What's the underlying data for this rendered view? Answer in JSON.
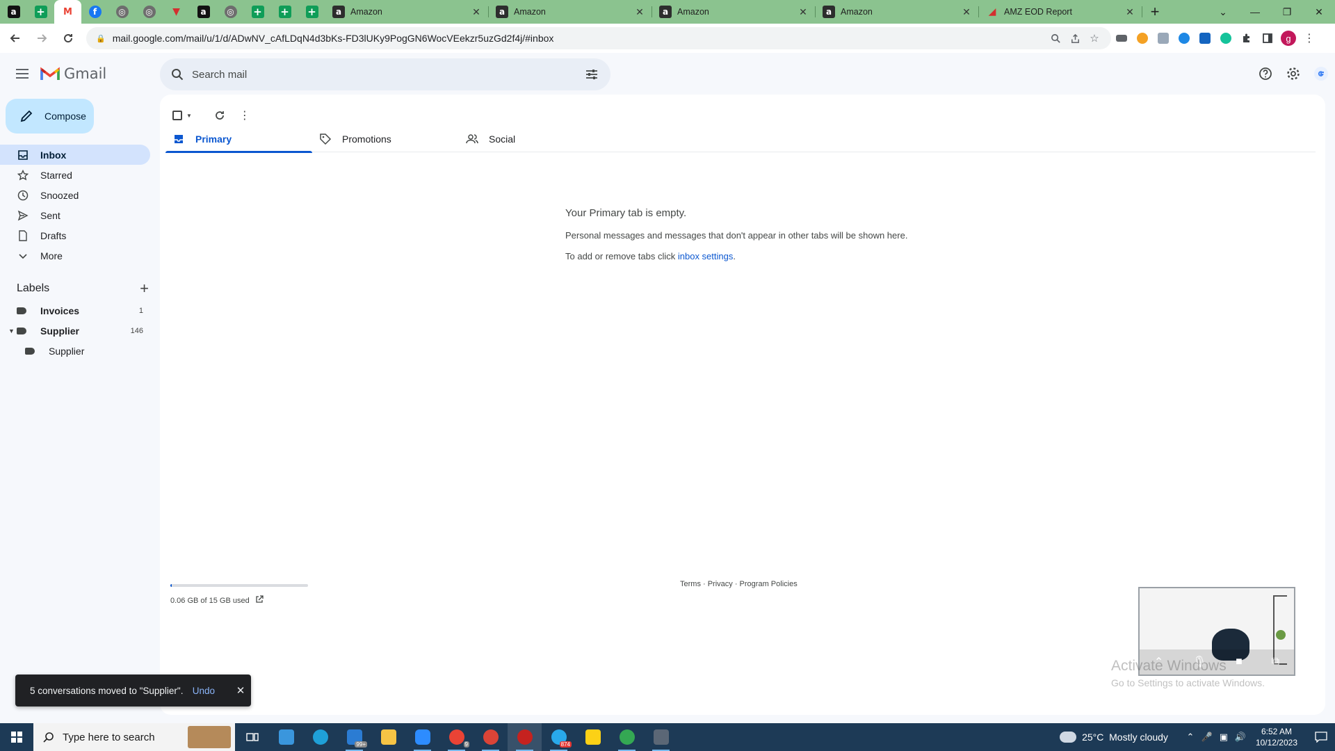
{
  "browser": {
    "pinned_tabs": [
      {
        "icon": "amazon-icon",
        "glyph": "a"
      },
      {
        "icon": "sheets-icon",
        "glyph": "+"
      },
      {
        "icon": "gmail-icon",
        "glyph": "M",
        "active": true
      },
      {
        "icon": "facebook-icon",
        "glyph": "f"
      },
      {
        "icon": "globe-icon",
        "glyph": "◎"
      },
      {
        "icon": "globe-icon",
        "glyph": "◎"
      },
      {
        "icon": "red-v-icon",
        "glyph": "▼"
      },
      {
        "icon": "amazon-icon",
        "glyph": "a"
      },
      {
        "icon": "globe-icon",
        "glyph": "◎"
      },
      {
        "icon": "sheets-icon",
        "glyph": "+"
      },
      {
        "icon": "sheets-icon",
        "glyph": "+"
      },
      {
        "icon": "sheets-icon",
        "glyph": "+"
      }
    ],
    "tabs": [
      {
        "title": "Amazon",
        "icon": "amazon-icon"
      },
      {
        "title": "Amazon",
        "icon": "amazon-icon"
      },
      {
        "title": "Amazon",
        "icon": "amazon-icon"
      },
      {
        "title": "Amazon",
        "icon": "amazon-icon"
      },
      {
        "title": "AMZ EOD Report",
        "icon": "looker-icon"
      }
    ],
    "url": "mail.google.com/mail/u/1/d/ADwNV_cAfLDqN4d3bKs-FD3lUKy9PogGN6WocVEekzr5uzGd2f4j/#inbox",
    "profile_initial": "g"
  },
  "gmail": {
    "brand": "Gmail",
    "search_placeholder": "Search mail",
    "compose_label": "Compose",
    "nav": [
      {
        "label": "Inbox",
        "icon": "inbox-icon",
        "active": true
      },
      {
        "label": "Starred",
        "icon": "star-icon"
      },
      {
        "label": "Snoozed",
        "icon": "clock-icon"
      },
      {
        "label": "Sent",
        "icon": "send-icon"
      },
      {
        "label": "Drafts",
        "icon": "draft-icon"
      },
      {
        "label": "More",
        "icon": "chevron-down-icon"
      }
    ],
    "labels_title": "Labels",
    "labels": [
      {
        "name": "Invoices",
        "count": "1"
      },
      {
        "name": "Supplier",
        "count": "146"
      },
      {
        "name": "Supplier",
        "count": ""
      }
    ],
    "tabs": [
      {
        "label": "Primary",
        "icon": "inbox-icon",
        "active": true
      },
      {
        "label": "Promotions",
        "icon": "tag-icon"
      },
      {
        "label": "Social",
        "icon": "people-icon"
      }
    ],
    "empty_title": "Your Primary tab is empty.",
    "empty_body": "Personal messages and messages that don't appear in other tabs will be shown here.",
    "empty_settings_prefix": "To add or remove tabs click ",
    "empty_settings_link": "inbox settings",
    "empty_settings_suffix": ".",
    "storage_text": "0.06 GB of 15 GB used",
    "storage_fraction": 0.004,
    "footer_links": "Terms · Privacy · Program Policies",
    "toast_message": "5 conversations moved to \"Supplier\".",
    "toast_undo": "Undo"
  },
  "watermark": {
    "line1": "Activate Windows",
    "line2": "Go to Settings to activate Windows."
  },
  "taskbar": {
    "search_placeholder": "Type here to search",
    "temperature": "25°C",
    "weather": "Mostly cloudy",
    "time": "6:52 AM",
    "date": "10/12/2023",
    "badges": {
      "mail": "99+",
      "chrome": "9",
      "telegram": "874"
    }
  },
  "colors": {
    "accent": "#0b57d0",
    "compose_bg": "#c2e7ff",
    "active_nav_bg": "#d3e3fd",
    "tabstrip": "#8bc38f",
    "taskbar": "#1d3a56"
  }
}
